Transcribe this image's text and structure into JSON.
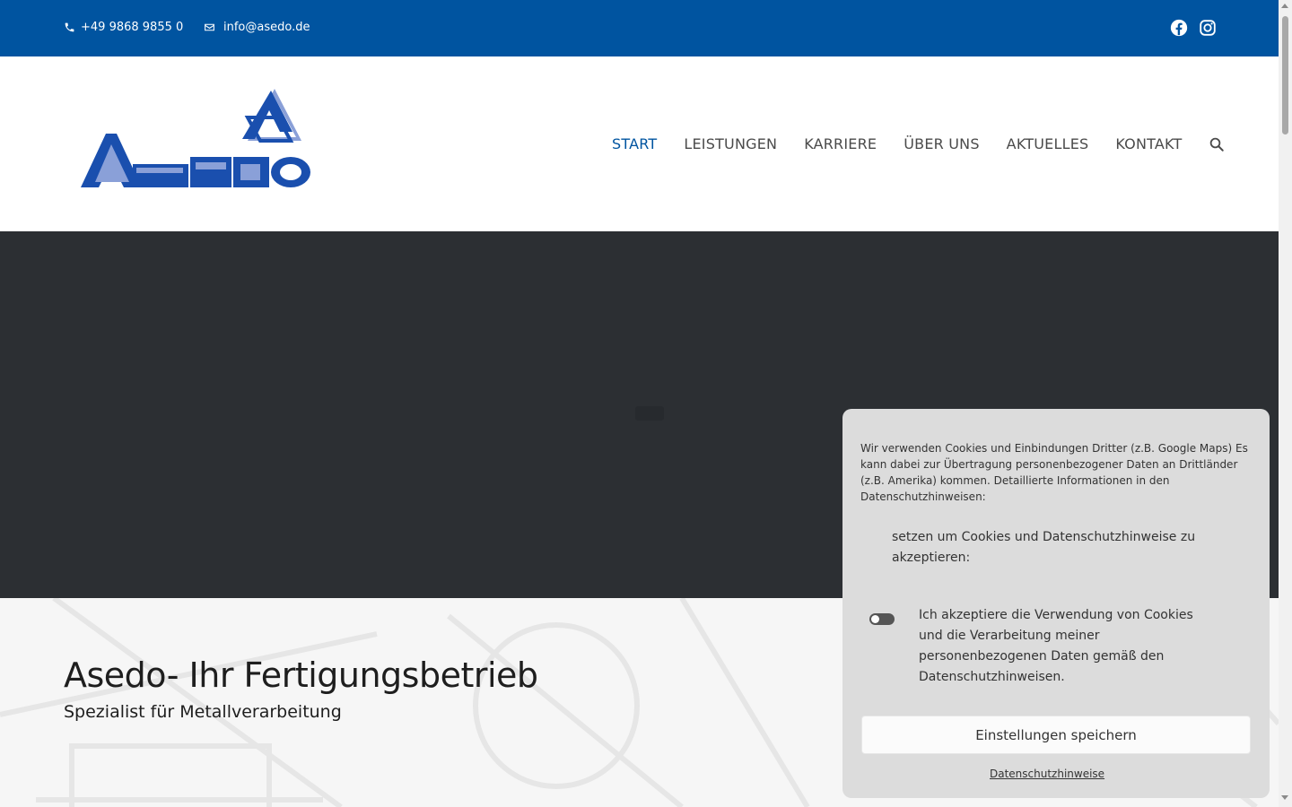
{
  "topbar": {
    "phone": "+49 9868 9855 0",
    "email": "info@asedo.de",
    "social": [
      "facebook-icon",
      "instagram-icon"
    ]
  },
  "logo": {
    "brand_color": "#0054a0"
  },
  "nav": {
    "items": [
      {
        "label": "START",
        "active": true
      },
      {
        "label": "LEISTUNGEN"
      },
      {
        "label": "KARRIERE"
      },
      {
        "label": "ÜBER UNS"
      },
      {
        "label": "AKTUELLES"
      },
      {
        "label": "KONTAKT"
      }
    ],
    "search_icon": "search-icon"
  },
  "hero": {},
  "content": {
    "title": "Asedo- Ihr Fertigungsbetrieb",
    "subtitle": "Spezialist für Metallverarbeitung"
  },
  "cookie": {
    "intro": "Wir verwenden Cookies und Einbindungen Dritter (z.B. Google Maps) Es kann dabei zur Übertragung personenbezogener Daten an Drittländer (z.B. Amerika) kommen. Detaillierte Informationen in den Datenschutzhinweisen:",
    "note": "setzen um Cookies und Datenschutzhinweise zu akzeptieren:",
    "accept_label": "Ich akzeptiere die Verwendung von Cookies und die Verarbeitung meiner personenbezogenen Daten gemäß den Datenschutzhinweisen.",
    "save_button": "Einstellungen speichern",
    "privacy_link": "Datenschutzhinweise"
  },
  "colors": {
    "brand_blue": "#0054a0",
    "hero_bg": "#2c2f33",
    "cookie_bg": "#dcdcdc"
  }
}
